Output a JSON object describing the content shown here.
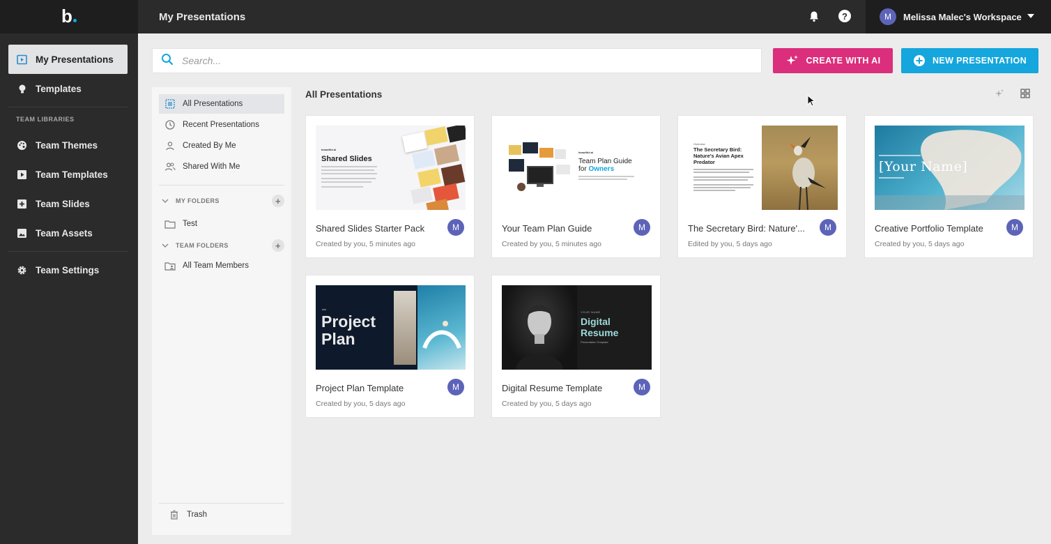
{
  "app": {
    "logo_text": "b"
  },
  "sidebar": {
    "items": [
      {
        "label": "My Presentations",
        "icon": "presentation-icon"
      },
      {
        "label": "Templates",
        "icon": "lightbulb-icon"
      }
    ],
    "section_label": "TEAM LIBRARIES",
    "team_items": [
      {
        "label": "Team Themes",
        "icon": "palette-icon"
      },
      {
        "label": "Team Templates",
        "icon": "play-box-icon"
      },
      {
        "label": "Team Slides",
        "icon": "add-box-icon"
      },
      {
        "label": "Team Assets",
        "icon": "image-icon"
      }
    ],
    "settings_label": "Team Settings"
  },
  "topbar": {
    "title": "My Presentations",
    "workspace_name": "Melissa Malec's Workspace",
    "avatar_letter": "M"
  },
  "search": {
    "placeholder": "Search..."
  },
  "buttons": {
    "create_ai": "CREATE WITH AI",
    "new_presentation": "NEW PRESENTATION"
  },
  "filters": {
    "items": [
      {
        "label": "All Presentations"
      },
      {
        "label": "Recent Presentations"
      },
      {
        "label": "Created By Me"
      },
      {
        "label": "Shared With Me"
      }
    ],
    "my_folders_label": "MY FOLDERS",
    "my_folders": [
      {
        "label": "Test"
      }
    ],
    "team_folders_label": "TEAM FOLDERS",
    "team_folders": [
      {
        "label": "All Team Members"
      }
    ],
    "trash_label": "Trash"
  },
  "content": {
    "section_title": "All Presentations",
    "cards": [
      {
        "title": "Shared Slides Starter Pack",
        "subtitle": "Created by you, 5 minutes ago",
        "avatar": "M",
        "thumb_heading": "Shared Slides",
        "thumb_brand": "beautiful.ai"
      },
      {
        "title": "Your Team Plan Guide",
        "subtitle": "Created by you, 5 minutes ago",
        "avatar": "M",
        "thumb_heading_1": "Team Plan Guide",
        "thumb_heading_2": "for",
        "thumb_heading_3": "Owners",
        "thumb_brand": "beautiful.ai"
      },
      {
        "title": "The Secretary Bird: Nature'...",
        "subtitle": "Edited by you, 5 days ago",
        "avatar": "M",
        "thumb_heading": "The Secretary Bird: Nature's Avian Apex Predator",
        "thumb_overline": "Overview"
      },
      {
        "title": "Creative Portfolio Template",
        "subtitle": "Created by you, 5 days ago",
        "avatar": "M",
        "thumb_heading": "[Your Name]"
      },
      {
        "title": "Project Plan Template",
        "subtitle": "Created by you, 5 days ago",
        "avatar": "M",
        "thumb_heading_1": "Project",
        "thumb_heading_2": "Plan"
      },
      {
        "title": "Digital Resume Template",
        "subtitle": "Created by you, 5 days ago",
        "avatar": "M",
        "thumb_heading_1": "Digital",
        "thumb_heading_2": "Resume",
        "thumb_overline": "YOUR NAME",
        "thumb_sub": "Presentation Template"
      }
    ]
  },
  "colors": {
    "sidebar_bg": "#2b2b2b",
    "ai_button": "#db2e7c",
    "new_button": "#14a6dc",
    "avatar": "#5c63b8",
    "accent_blue": "#11a9e2"
  }
}
